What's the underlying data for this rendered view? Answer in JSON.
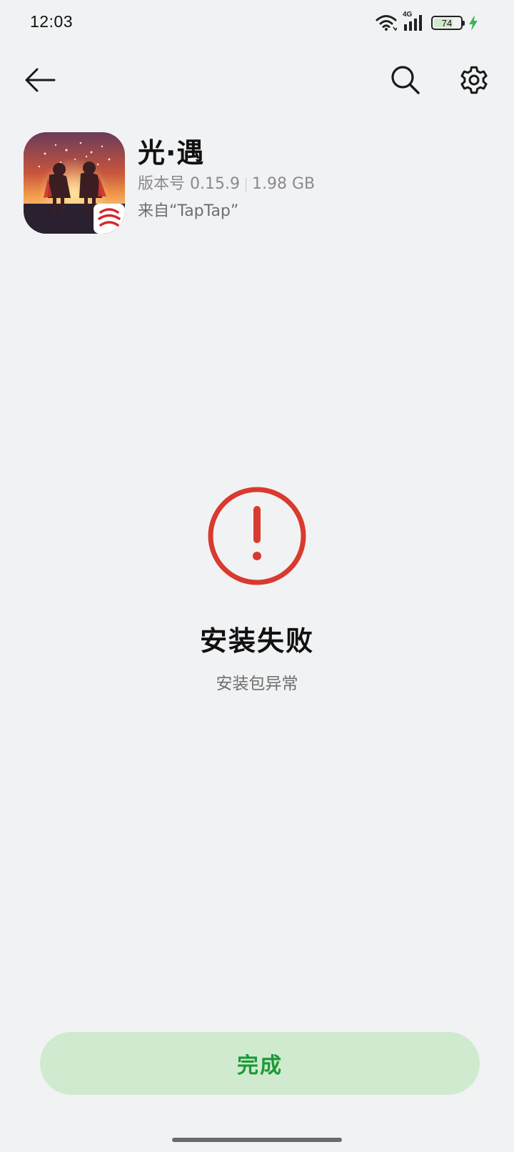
{
  "status_bar": {
    "time": "12:03",
    "network_label": "4G",
    "battery_level": "74",
    "battery_percent": 0.74,
    "charging": true,
    "icons": [
      "wifi-icon",
      "cellular-signal-icon",
      "battery-icon",
      "charging-bolt-icon"
    ]
  },
  "toolbar": {
    "icons": [
      "back-arrow-icon",
      "search-icon",
      "gear-icon"
    ]
  },
  "app": {
    "name": "光·遇",
    "version": "版本号 0.15.9",
    "size": "1.98 GB",
    "source": "来自“TapTap”"
  },
  "result": {
    "title": "安装失败",
    "subtitle": "安装包异常",
    "icon": "error-exclamation-icon",
    "accent_color": "#d93a2f"
  },
  "actions": {
    "done_label": "完成",
    "done_text_color": "#1b9a35",
    "done_bg_color": "#cfeacf"
  }
}
